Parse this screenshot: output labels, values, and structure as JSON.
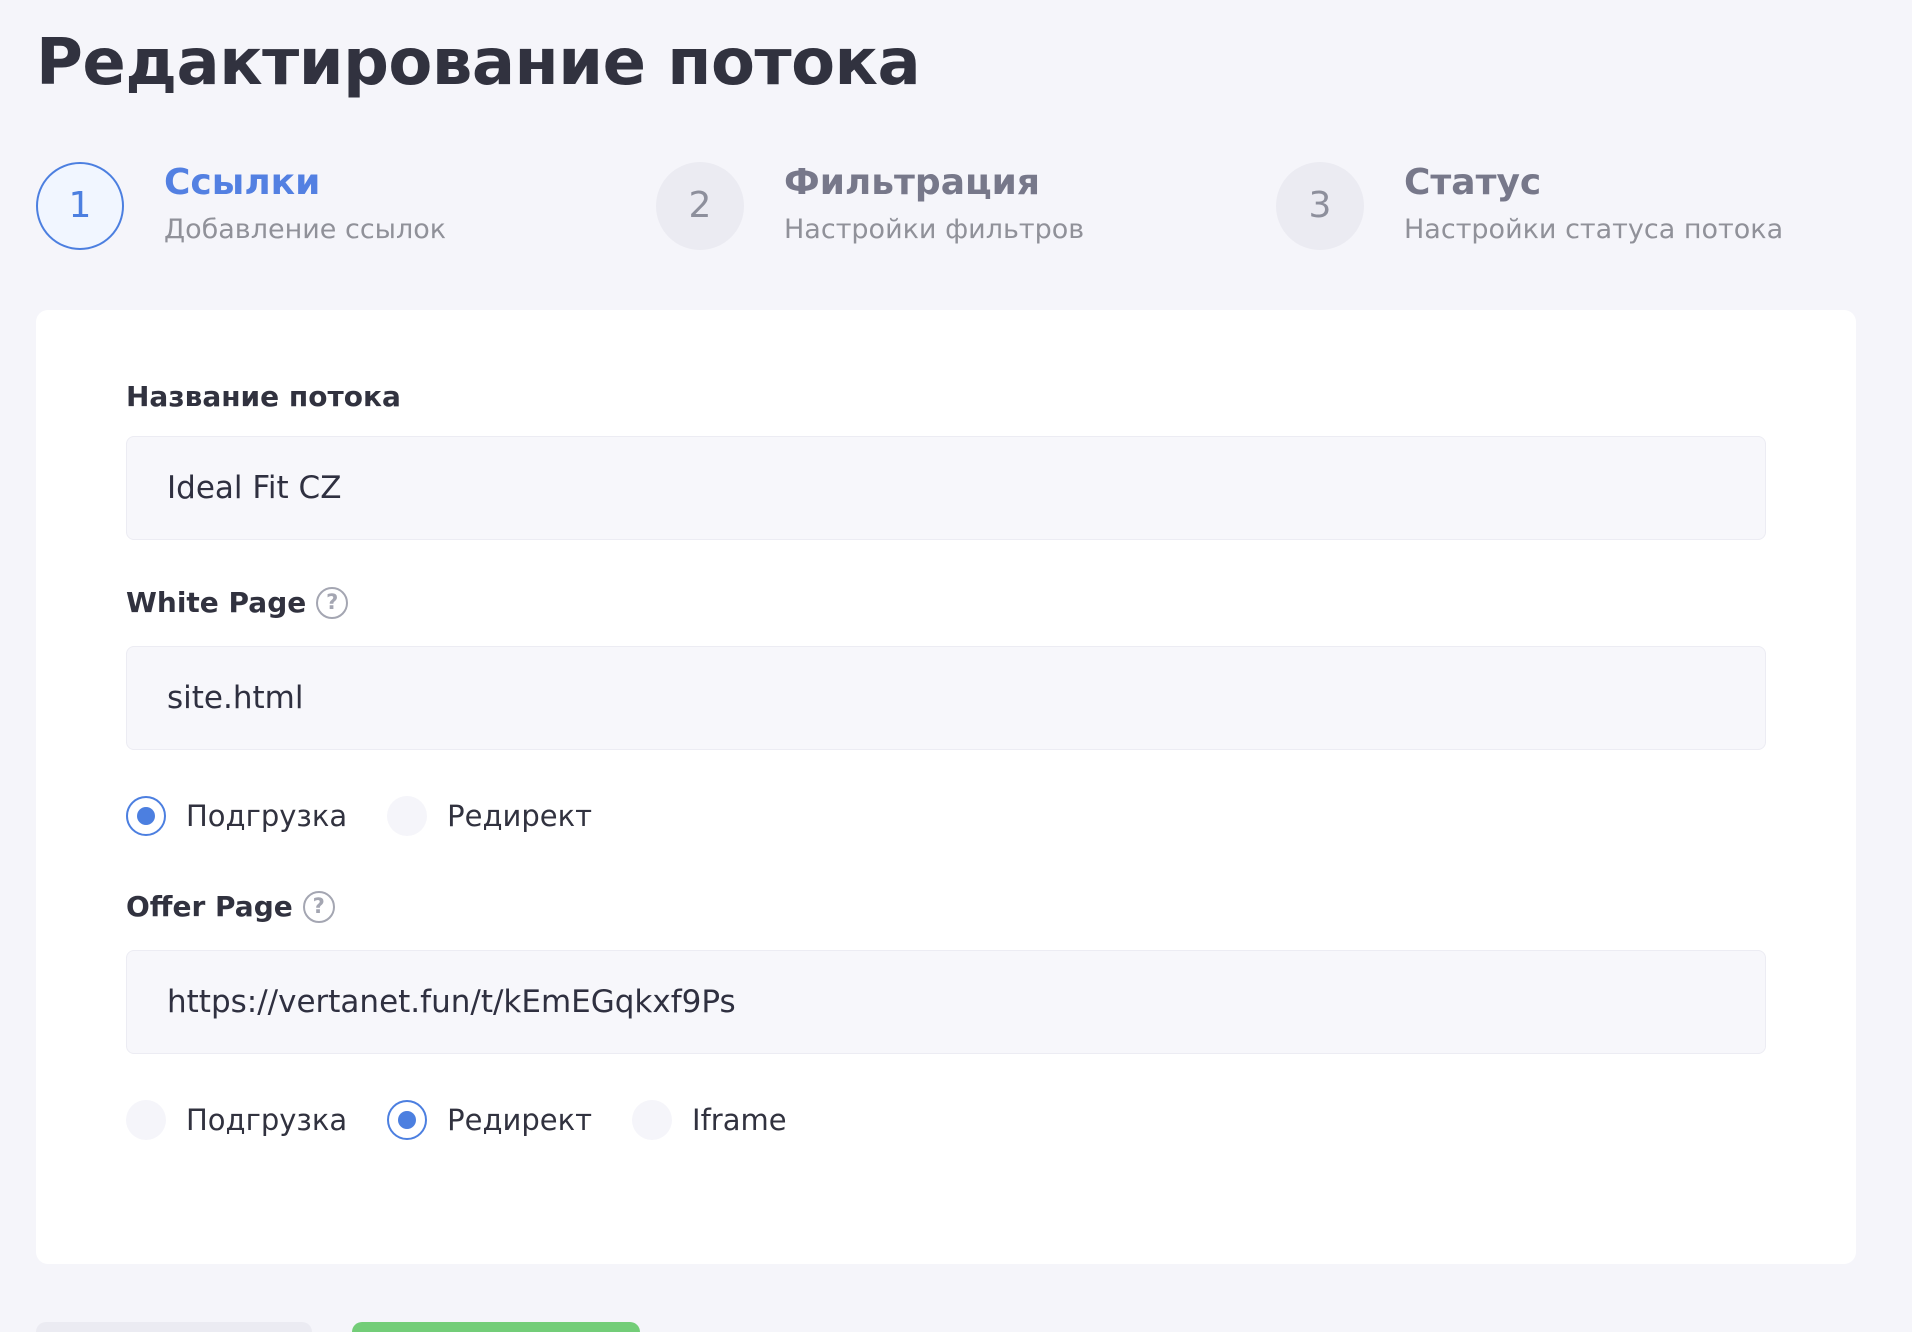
{
  "page": {
    "title": "Редактирование потока"
  },
  "stepper": {
    "steps": [
      {
        "number": "1",
        "title": "Ссылки",
        "subtitle": "Добавление ссылок"
      },
      {
        "number": "2",
        "title": "Фильтрация",
        "subtitle": "Настройки фильтров"
      },
      {
        "number": "3",
        "title": "Статус",
        "subtitle": "Настройки статуса потока"
      }
    ]
  },
  "form": {
    "stream_name": {
      "label": "Название потока",
      "value": "Ideal Fit CZ"
    },
    "white_page": {
      "label": "White Page",
      "help_icon": "?",
      "value": "site.html",
      "options": [
        "Подгрузка",
        "Редирект"
      ],
      "selected": "Подгрузка"
    },
    "offer_page": {
      "label": "Offer Page",
      "help_icon": "?",
      "value": "https://vertanet.fun/t/kEmEGqkxf9Ps",
      "options": [
        "Подгрузка",
        "Редирект",
        "Iframe"
      ],
      "selected": "Редирект"
    }
  },
  "colors": {
    "accent": "#4c7fe0",
    "next_button": "#73cd78",
    "background": "#f5f5fa"
  }
}
